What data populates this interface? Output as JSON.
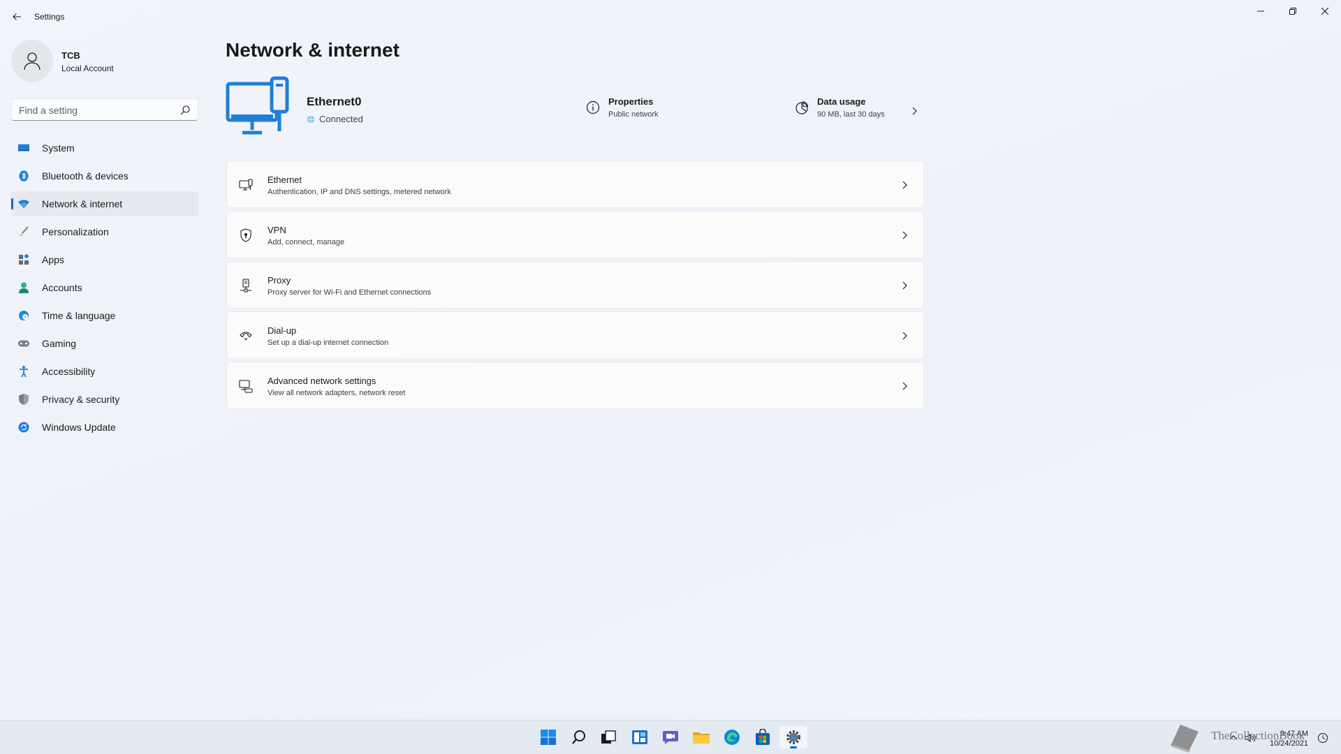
{
  "window": {
    "title": "Settings"
  },
  "profile": {
    "name": "TCB",
    "account_type": "Local Account"
  },
  "search": {
    "placeholder": "Find a setting"
  },
  "sidebar": {
    "items": [
      {
        "label": "System",
        "icon": "system-icon"
      },
      {
        "label": "Bluetooth & devices",
        "icon": "bluetooth-icon"
      },
      {
        "label": "Network & internet",
        "icon": "wifi-icon",
        "active": true
      },
      {
        "label": "Personalization",
        "icon": "brush-icon"
      },
      {
        "label": "Apps",
        "icon": "apps-icon"
      },
      {
        "label": "Accounts",
        "icon": "person-icon"
      },
      {
        "label": "Time & language",
        "icon": "globe-clock-icon"
      },
      {
        "label": "Gaming",
        "icon": "gamepad-icon"
      },
      {
        "label": "Accessibility",
        "icon": "accessibility-icon"
      },
      {
        "label": "Privacy & security",
        "icon": "shield-icon"
      },
      {
        "label": "Windows Update",
        "icon": "update-icon"
      }
    ]
  },
  "main": {
    "title": "Network & internet",
    "connection": {
      "name": "Ethernet0",
      "status": "Connected"
    },
    "properties": {
      "title": "Properties",
      "subtitle": "Public network"
    },
    "data_usage": {
      "title": "Data usage",
      "subtitle": "90 MB, last 30 days"
    },
    "cards": [
      {
        "title": "Ethernet",
        "subtitle": "Authentication, IP and DNS settings, metered network",
        "icon": "ethernet-icon"
      },
      {
        "title": "VPN",
        "subtitle": "Add, connect, manage",
        "icon": "vpn-shield-icon"
      },
      {
        "title": "Proxy",
        "subtitle": "Proxy server for Wi-Fi and Ethernet connections",
        "icon": "proxy-icon"
      },
      {
        "title": "Dial-up",
        "subtitle": "Set up a dial-up internet connection",
        "icon": "dialup-icon"
      },
      {
        "title": "Advanced network settings",
        "subtitle": "View all network adapters, network reset",
        "icon": "network-adapter-icon"
      }
    ]
  },
  "taskbar": {
    "apps": [
      "start-icon",
      "search-icon",
      "task-view-icon",
      "widgets-icon",
      "chat-icon",
      "file-explorer-icon",
      "edge-icon",
      "store-icon",
      "settings-icon"
    ],
    "time": "9:47 AM",
    "date": "10/24/2021"
  },
  "watermark": {
    "text": "TheCollectionBook"
  },
  "colors": {
    "accent": "#0067c0",
    "background": "#eef2f8"
  }
}
